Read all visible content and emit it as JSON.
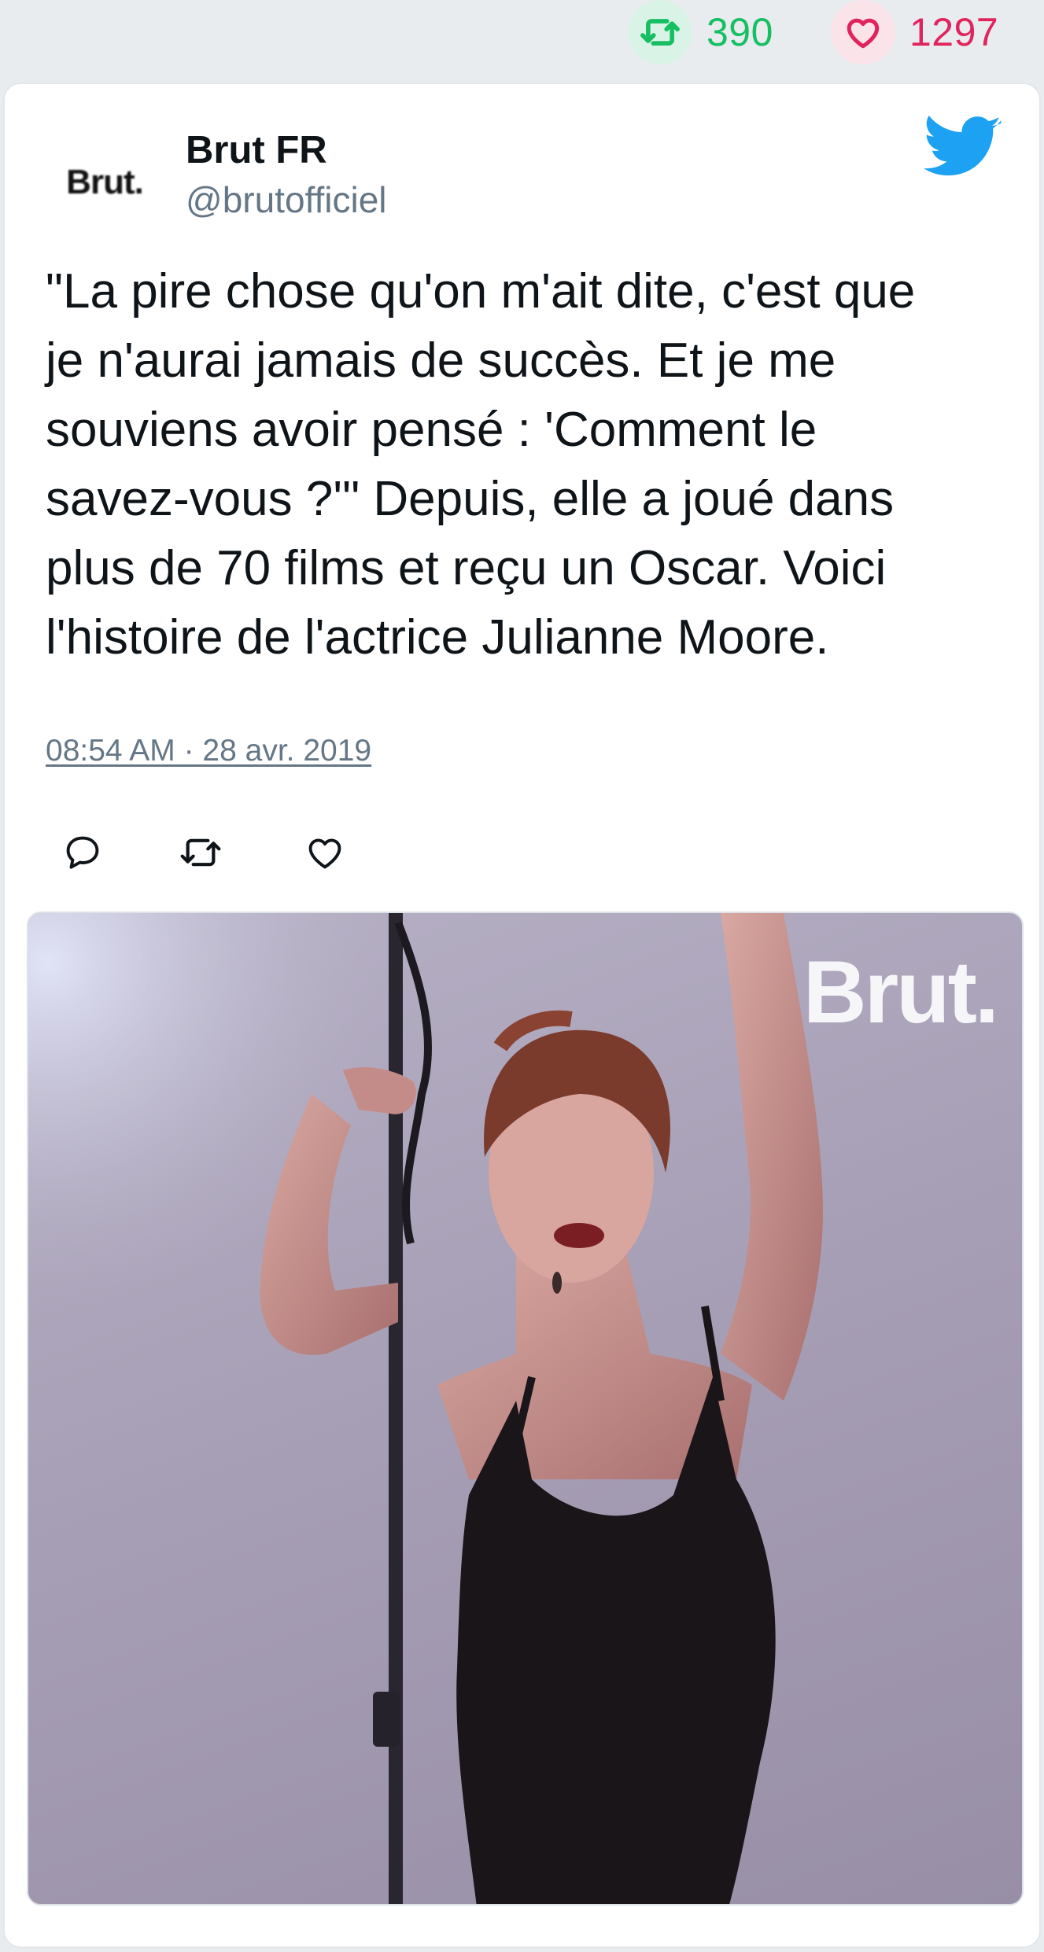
{
  "stats": {
    "retweet_count": "390",
    "like_count": "1297",
    "retweet_icon": "retweet-icon",
    "like_icon": "heart-icon",
    "retweet_color": "#17bf63",
    "like_color": "#e0245e"
  },
  "tweet": {
    "avatar_text": "Brut.",
    "display_name": "Brut FR",
    "handle": "@brutofficiel",
    "text": "\"La pire chose qu'on m'ait dite, c'est que\nje n'aurai jamais de succès. Et je me\nsouviens avoir pensé : 'Comment le\nsavez-vous ?'\" Depuis, elle a joué dans\nplus de 70 films et reçu un Oscar. Voici\nl'histoire de l'actrice Julianne Moore.",
    "timestamp": "08:54 AM · 28 avr. 2019",
    "brand_icon": "twitter-bird-icon",
    "brand_color": "#1da1f2"
  },
  "actions": {
    "reply_icon": "reply-icon",
    "retweet_icon": "retweet-icon",
    "like_icon": "heart-icon"
  },
  "media": {
    "watermark": "Brut."
  }
}
